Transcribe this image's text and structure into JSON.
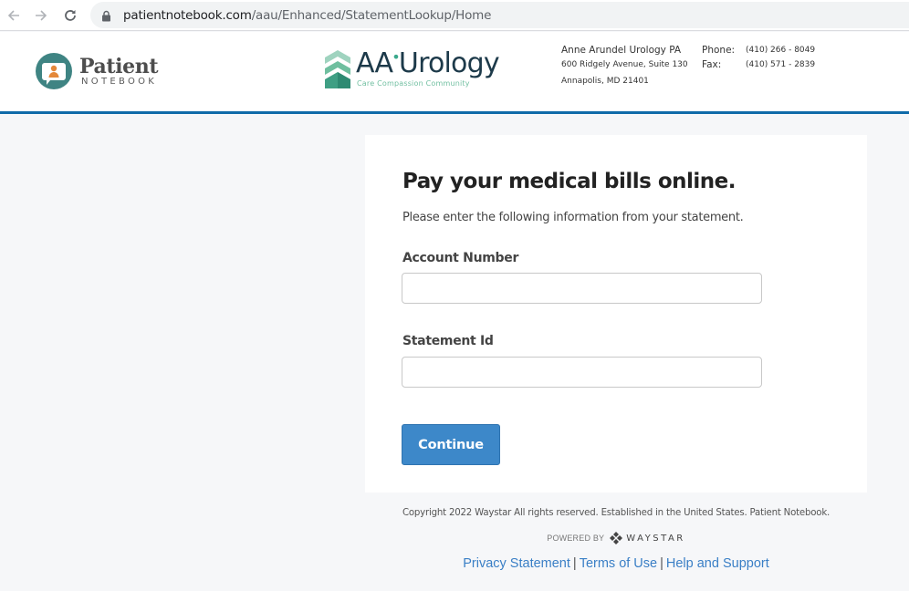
{
  "browser": {
    "url_host": "patientnotebook.com",
    "url_path": "/aau/Enhanced/StatementLookup/Home",
    "icons": [
      "back-arrow-icon",
      "forward-arrow-icon",
      "reload-icon",
      "lock-icon"
    ]
  },
  "header": {
    "patient_notebook_logo": {
      "title": "Patient",
      "subtitle": "NOTEBOOK"
    },
    "practice_logo": {
      "title_left": "AA",
      "title_right": "Urology",
      "tagline": "Care  Compassion  Community"
    },
    "contact": {
      "name": "Anne Arundel Urology PA",
      "address_line1": "600 Ridgely Avenue, Suite 130",
      "address_line2": "Annapolis, MD 21401",
      "phone_label": "Phone:",
      "phone": "(410) 266 - 8049",
      "fax_label": "Fax:",
      "fax": "(410) 571 - 2839"
    },
    "accent_color": "#0f6aa9"
  },
  "form": {
    "title": "Pay your medical bills online.",
    "subtitle": "Please enter the following information from your statement.",
    "account_number": {
      "label": "Account Number",
      "value": "",
      "placeholder": ""
    },
    "statement_id": {
      "label": "Statement Id",
      "value": "",
      "placeholder": ""
    },
    "continue_label": "Continue",
    "button_color": "#3d88c9"
  },
  "footer": {
    "copyright": "Copyright 2022 Waystar All rights reserved. Established in the United States. Patient Notebook.",
    "powered_by": "POWERED BY",
    "powered_brand": "WAYSTAR",
    "links": [
      {
        "label": "Privacy Statement"
      },
      {
        "label": "Terms of Use"
      },
      {
        "label": "Help and Support"
      }
    ],
    "separator": "|",
    "link_color": "#3a7fc6"
  }
}
